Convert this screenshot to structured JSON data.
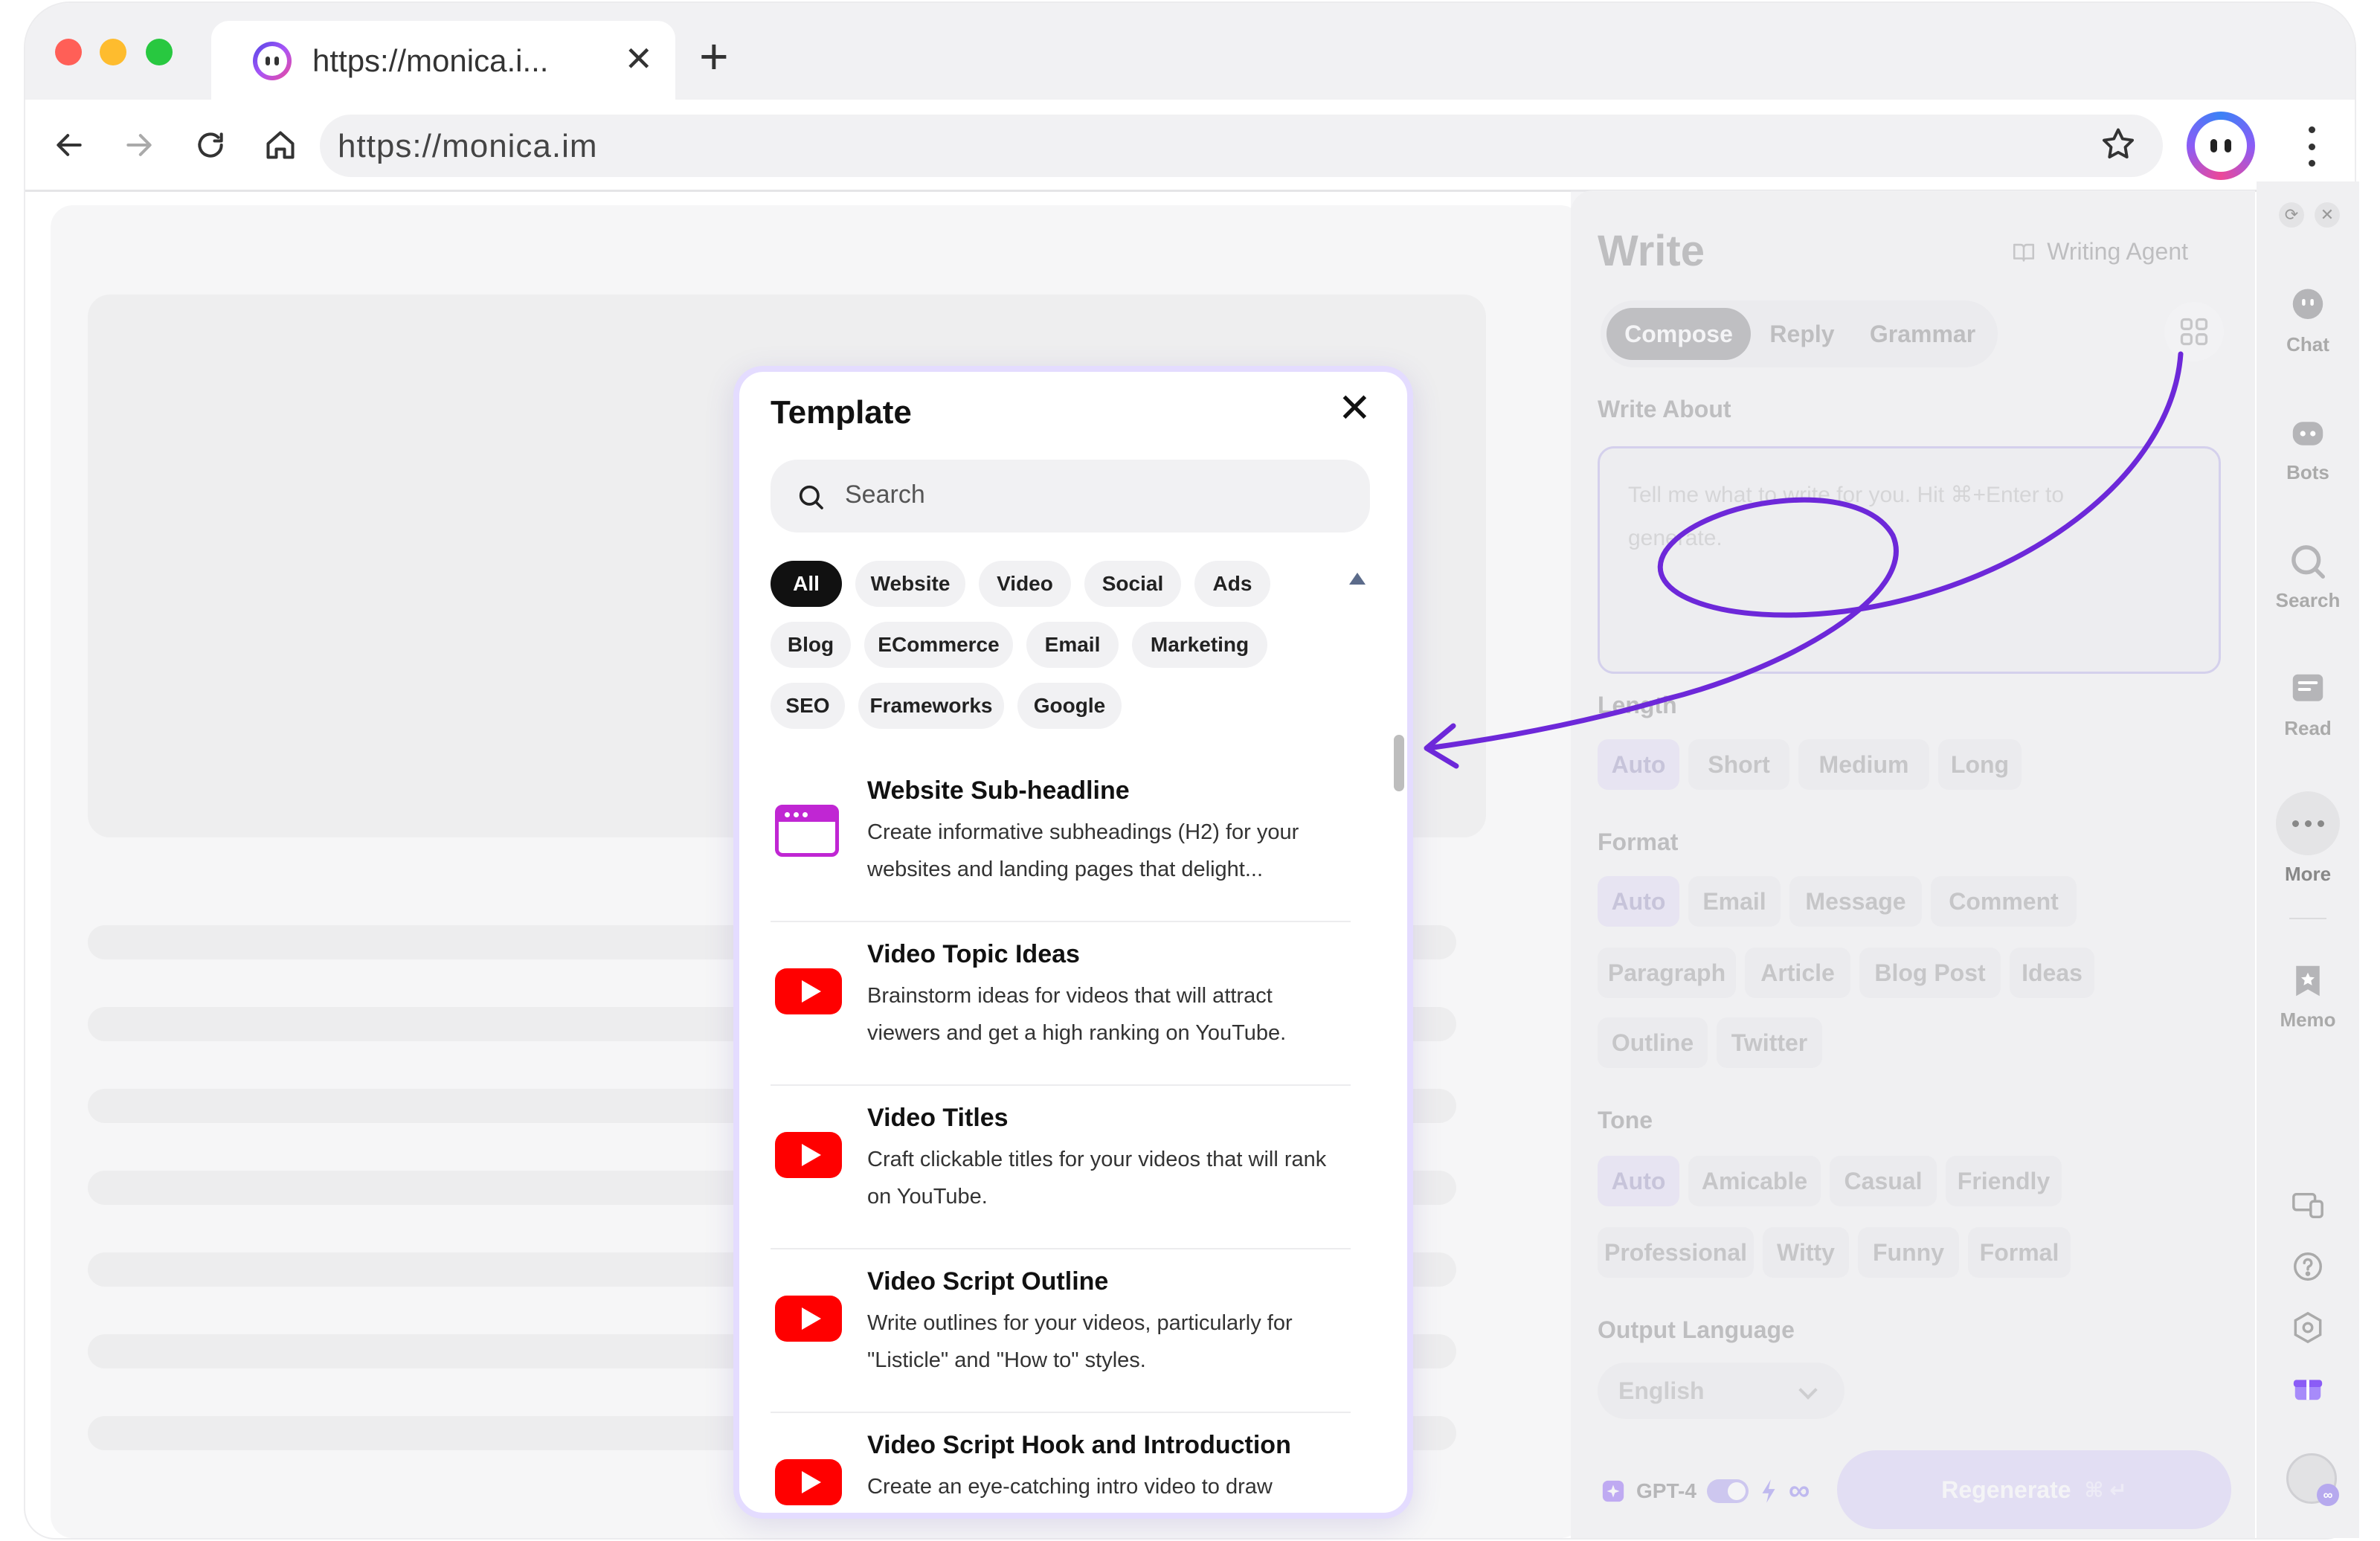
{
  "browser": {
    "tab_title": "https://monica.i...",
    "tab_close": "✕",
    "new_tab": "+",
    "url": "https://monica.im"
  },
  "template_popup": {
    "title": "Template",
    "close": "✕",
    "search_placeholder": "Search",
    "chips": [
      "All",
      "Website",
      "Video",
      "Social",
      "Ads",
      "Blog",
      "ECommerce",
      "Email",
      "Marketing",
      "SEO",
      "Frameworks",
      "Google"
    ],
    "active_chip": "All",
    "items": [
      {
        "name": "Website Sub-headline",
        "desc": "Create informative subheadings (H2) for your websites and landing pages that delight...",
        "icon": "website-icon"
      },
      {
        "name": "Video Topic Ideas",
        "desc": "Brainstorm ideas for videos that will attract viewers and get a high ranking on YouTube.",
        "icon": "youtube-icon"
      },
      {
        "name": "Video Titles",
        "desc": "Craft clickable titles for your videos that will rank on YouTube.",
        "icon": "youtube-icon"
      },
      {
        "name": "Video Script Outline",
        "desc": "Write outlines for your videos, particularly for \"Listicle\" and \"How to\" styles.",
        "icon": "youtube-icon"
      },
      {
        "name": "Video Script Hook and Introduction",
        "desc": "Create an eye-catching intro video to draw",
        "icon": "youtube-icon"
      }
    ]
  },
  "panel": {
    "title": "Write",
    "agent_label": "Writing Agent",
    "tabs": [
      "Compose",
      "Reply",
      "Grammar"
    ],
    "active_tab": "Compose",
    "write_about_label": "Write About",
    "textarea_placeholder": "Tell me what to write for you. Hit ⌘+Enter to generate.",
    "length_label": "Length",
    "length_options": [
      "Auto",
      "Short",
      "Medium",
      "Long"
    ],
    "format_label": "Format",
    "format_options": [
      "Auto",
      "Email",
      "Message",
      "Comment",
      "Paragraph",
      "Article",
      "Blog Post",
      "Ideas",
      "Outline",
      "Twitter"
    ],
    "tone_label": "Tone",
    "tone_options": [
      "Auto",
      "Amicable",
      "Casual",
      "Friendly",
      "Professional",
      "Witty",
      "Funny",
      "Formal"
    ],
    "output_language_label": "Output Language",
    "output_language": "English",
    "model": "GPT-4",
    "infinity": "∞",
    "regenerate_label": "Regenerate",
    "regenerate_shortcut": "⌘ ↵"
  },
  "rail": {
    "items": [
      {
        "label": "Chat",
        "icon": "chat-icon"
      },
      {
        "label": "Bots",
        "icon": "bots-icon"
      },
      {
        "label": "Search",
        "icon": "search-icon"
      },
      {
        "label": "Read",
        "icon": "read-icon"
      },
      {
        "label": "More",
        "icon": "more-icon"
      },
      {
        "label": "Memo",
        "icon": "memo-icon"
      }
    ],
    "avatar_badge": "∞"
  },
  "colors": {
    "accent": "#6d28d9",
    "selection_purple": "#e2dcf5",
    "youtube_red": "#ff0000",
    "website_magenta": "#c026d3"
  }
}
